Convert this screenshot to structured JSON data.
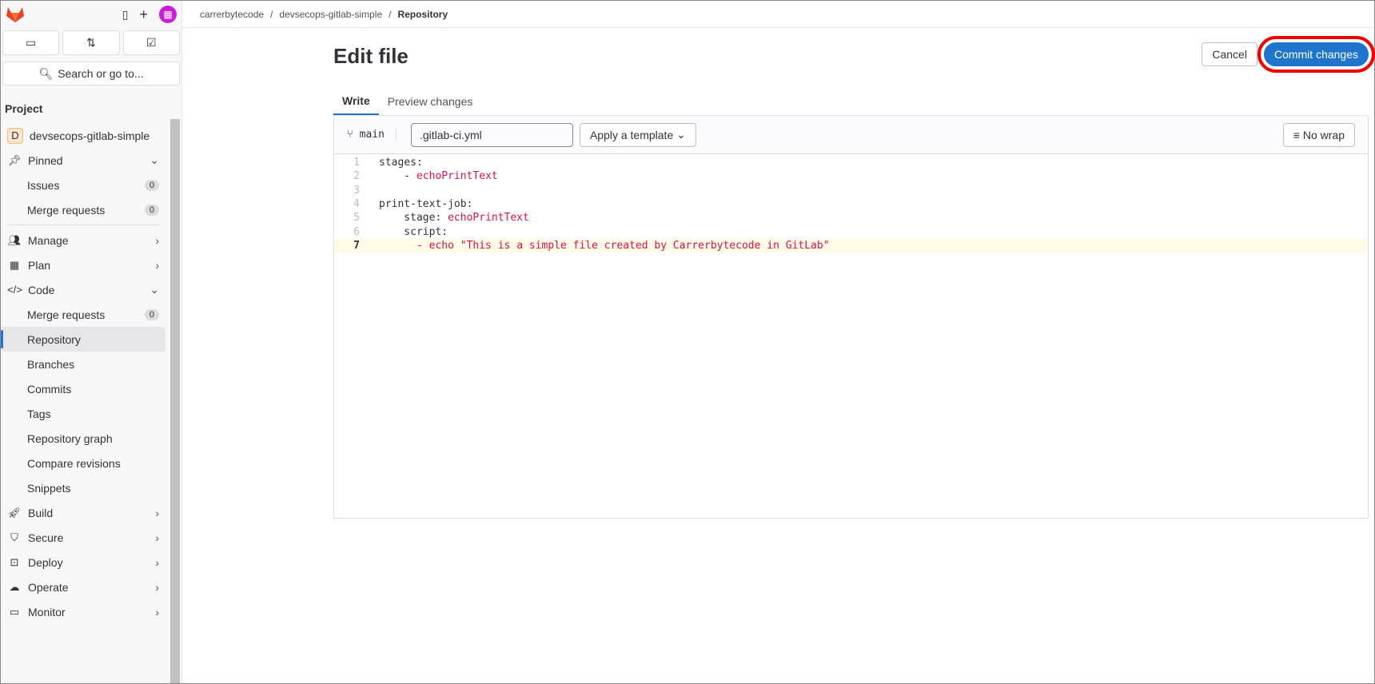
{
  "breadcrumb": [
    "carrerbytecode",
    "devsecops-gitlab-simple",
    "Repository"
  ],
  "sidebar": {
    "search": "Search or go to...",
    "section": "Project",
    "project_initial": "D",
    "project": "devsecops-gitlab-simple",
    "pinned": "Pinned",
    "issues": "Issues",
    "issues_count": "0",
    "mr": "Merge requests",
    "mr_count": "0",
    "manage": "Manage",
    "plan": "Plan",
    "code": "Code",
    "code_mr": "Merge requests",
    "code_mr_count": "0",
    "repository": "Repository",
    "branches": "Branches",
    "commits": "Commits",
    "tags": "Tags",
    "graph": "Repository graph",
    "compare": "Compare revisions",
    "snippets": "Snippets",
    "build": "Build",
    "secure": "Secure",
    "deploy": "Deploy",
    "operate": "Operate",
    "monitor": "Monitor"
  },
  "page": {
    "title": "Edit file",
    "cancel": "Cancel",
    "commit": "Commit changes",
    "tab_write": "Write",
    "tab_preview": "Preview changes"
  },
  "editor": {
    "branch": "main",
    "filename": ".gitlab-ci.yml",
    "template": "Apply a template",
    "nowrap": "No wrap",
    "lines": [
      {
        "n": "1",
        "k": "stages:",
        "v": ""
      },
      {
        "n": "2",
        "k": "    - ",
        "v": "echoPrintText"
      },
      {
        "n": "3",
        "k": "",
        "v": ""
      },
      {
        "n": "4",
        "k": "print-text-job:",
        "v": ""
      },
      {
        "n": "5",
        "k": "    stage: ",
        "v": "echoPrintText"
      },
      {
        "n": "6",
        "k": "    script:",
        "v": ""
      },
      {
        "n": "7",
        "k": "      ",
        "v": "- echo \"This is a simple file created by Carrerbytecode in GitLab\""
      }
    ]
  }
}
